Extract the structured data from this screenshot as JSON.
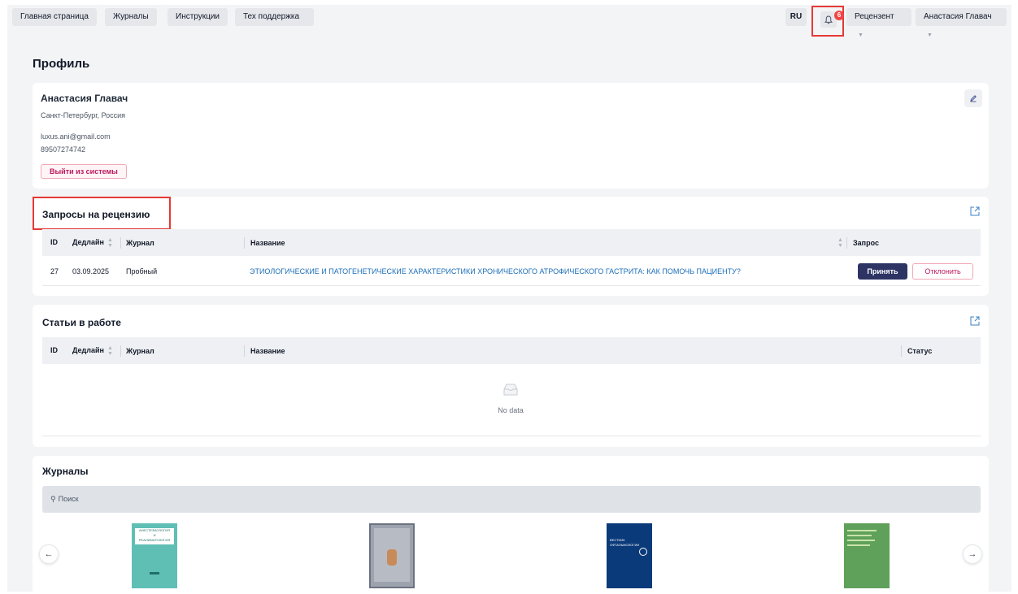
{
  "nav": {
    "home": "Главная страница",
    "journals": "Журналы",
    "instructions": "Инструкции",
    "support": "Тех поддержка",
    "lang": "RU",
    "notifications_count": "6",
    "role": "Рецензент",
    "user": "Анастасия Главач"
  },
  "page_title": "Профиль",
  "profile": {
    "name": "Анастасия Главач",
    "location": "Санкт-Петербург, Россия",
    "email": "luxus.ani@gmail.com",
    "phone": "89507274742",
    "logout": "Выйти из системы"
  },
  "review_requests": {
    "title": "Запросы на рецензию",
    "columns": {
      "id": "ID",
      "deadline": "Дедлайн",
      "journal": "Журнал",
      "name": "Название",
      "request": "Запрос"
    },
    "rows": [
      {
        "id": "27",
        "deadline": "03.09.2025",
        "journal": "Пробный",
        "name": "ЭТИОЛОГИЧЕСКИЕ И ПАТОГЕНЕТИЧЕСКИЕ ХАРАКТЕРИСТИКИ ХРОНИЧЕСКОГО АТРОФИЧЕСКОГО ГАСТРИТА: КАК ПОМОЧЬ ПАЦИЕНТУ?",
        "accept": "Принять",
        "reject": "Отклонить"
      }
    ]
  },
  "articles": {
    "title": "Статьи в работе",
    "columns": {
      "id": "ID",
      "deadline": "Дедлайн",
      "journal": "Журнал",
      "name": "Название",
      "status": "Статус"
    },
    "empty": "No data"
  },
  "journals": {
    "title": "Журналы",
    "search_placeholder": "Поиск",
    "covers": [
      {
        "label_line1": "АНЕСТЕЗИОЛОГИЯ",
        "label_line2": "И",
        "label_line3": "РЕАНИМАТОЛОГИЯ",
        "color": "#5fbfb5"
      },
      {
        "color": "#9ca3af"
      },
      {
        "label_line1": "ВЕСТНИК",
        "label_line2": "ОФТАЛЬМОЛОГИИ",
        "color": "#0b3a7a"
      },
      {
        "color": "#5fa05a"
      }
    ]
  },
  "colors": {
    "accent": "#2d3464",
    "danger": "#be185d",
    "highlight": "#e53935",
    "link": "#1d6fb8"
  }
}
